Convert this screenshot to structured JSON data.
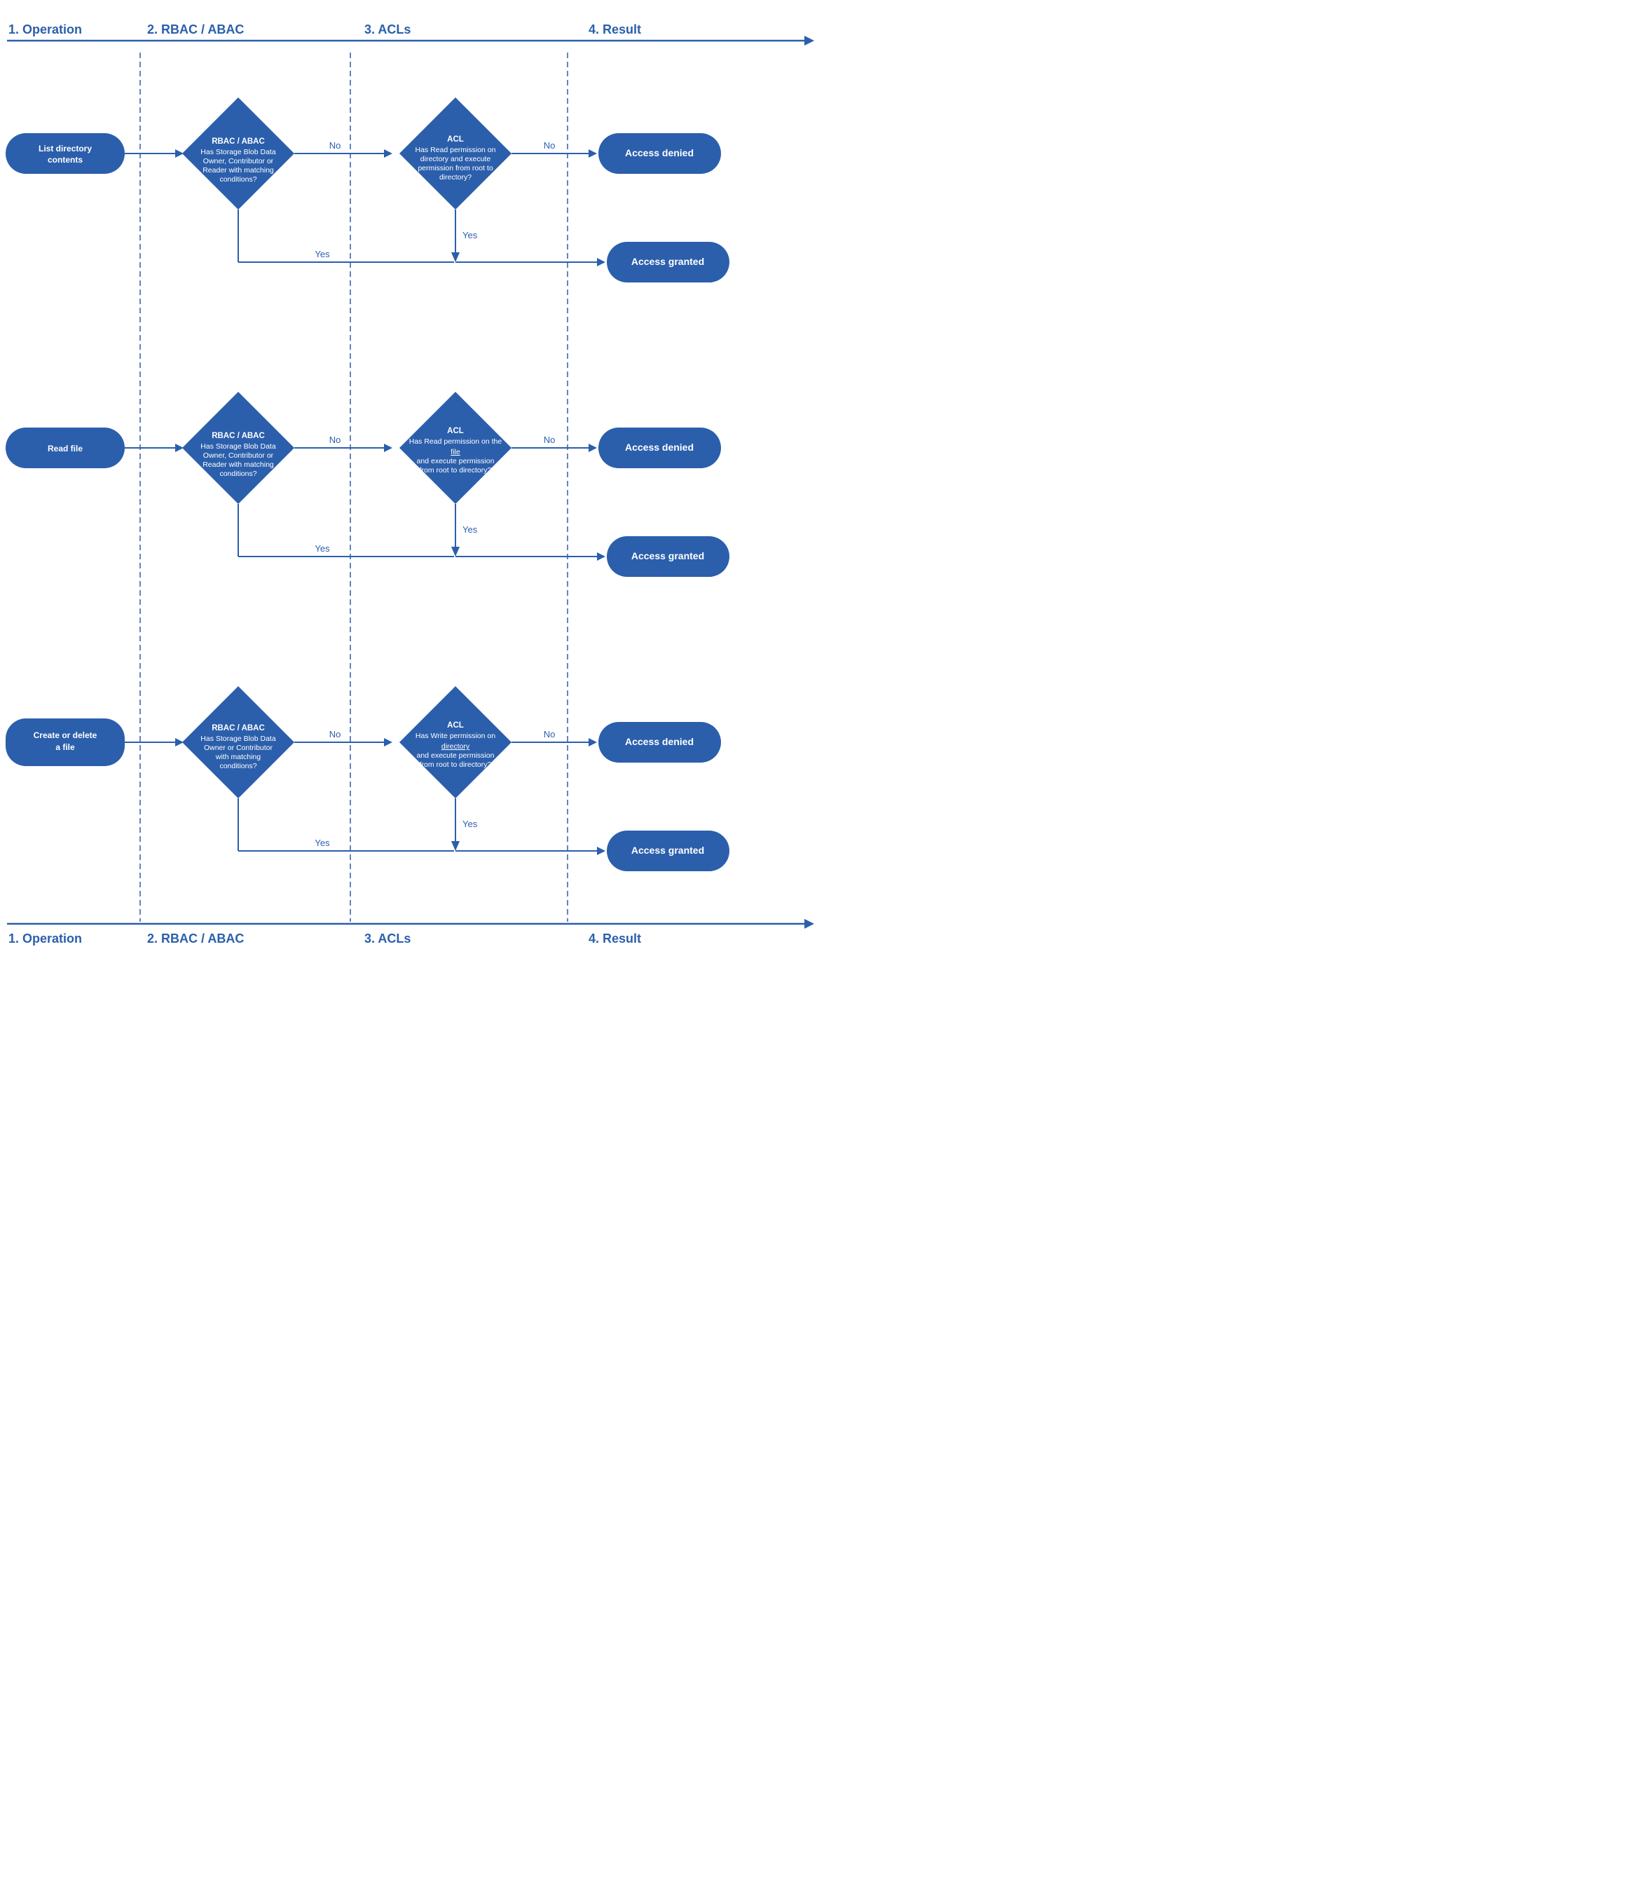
{
  "columns": {
    "col1": "1. Operation",
    "col2": "2. RBAC / ABAC",
    "col3": "3. ACLs",
    "col4": "4. Result"
  },
  "rows": [
    {
      "operation": "List directory contents",
      "rbac_title": "RBAC / ABAC",
      "rbac_question": "Has Storage Blob Data Owner, Contributor or Reader with matching conditions?",
      "acl_title": "ACL",
      "acl_question": "Has Read permission on directory and execute permission from root to directory?",
      "result_denied": "Access denied",
      "result_granted": "Access granted",
      "acl_underline": ""
    },
    {
      "operation": "Read file",
      "rbac_title": "RBAC / ABAC",
      "rbac_question": "Has Storage Blob Data Owner, Contributor or Reader with matching conditions?",
      "acl_title": "ACL",
      "acl_question": "Has Read permission on the file and execute permission from root to directory?",
      "result_denied": "Access denied",
      "result_granted": "Access granted",
      "acl_underline": "file"
    },
    {
      "operation": "Create or delete a file",
      "rbac_title": "RBAC / ABAC",
      "rbac_question": "Has Storage Blob Data Owner or Contributor with matching conditions?",
      "acl_title": "ACL",
      "acl_question": "Has Write permission on directory and execute permission from root to directory?",
      "result_denied": "Access denied",
      "result_granted": "Access granted",
      "acl_underline": "directory"
    }
  ],
  "labels": {
    "yes": "Yes",
    "no": "No"
  }
}
